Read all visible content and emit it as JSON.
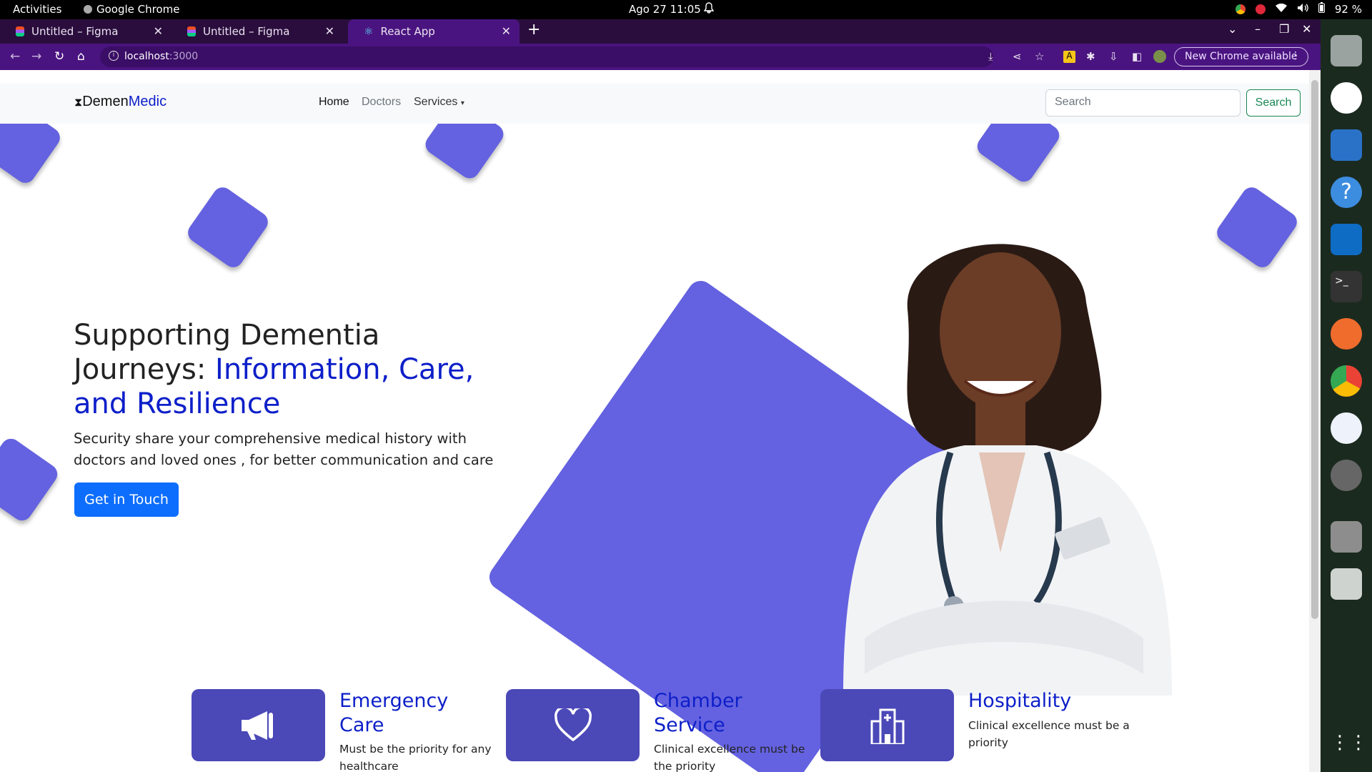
{
  "os": {
    "activities": "Activities",
    "app_name": "Google Chrome",
    "clock": "Ago 27  11:05",
    "battery": "92 %"
  },
  "browser": {
    "tabs": [
      {
        "title": "Untitled – Figma"
      },
      {
        "title": "Untitled – Figma"
      },
      {
        "title": "React App"
      }
    ],
    "url_host": "localhost",
    "url_port": ":3000",
    "new_chrome": "New Chrome available"
  },
  "site": {
    "brand_prefix": "Demen",
    "brand_suffix": "Medic",
    "nav": {
      "home": "Home",
      "doctors": "Doctors",
      "services": "Services"
    },
    "search_placeholder": "Search",
    "search_button": "Search",
    "hero": {
      "title_dark": "Supporting Dementia Journeys: ",
      "title_highlight": "Information, Care, and Resilience",
      "subtitle": "Security share your comprehensive medical history with doctors and loved ones , for better communication and care",
      "cta": "Get in Touch"
    },
    "services": [
      {
        "title": "Emergency Care",
        "desc": "Must be the priority for any healthcare",
        "icon": "megaphone-icon"
      },
      {
        "title": "Chamber Service",
        "desc": "Clinical excellence must be the priority",
        "icon": "heart-icon"
      },
      {
        "title": "Hospitality",
        "desc": "Clinical excellence must be a priority",
        "icon": "hospital-icon"
      }
    ]
  },
  "colors": {
    "accent": "#0d1fc9",
    "shape": "#6462e0",
    "service_box": "#4b48b8",
    "primary_button": "#0d6efd",
    "chrome_frame": "#4a1480"
  }
}
